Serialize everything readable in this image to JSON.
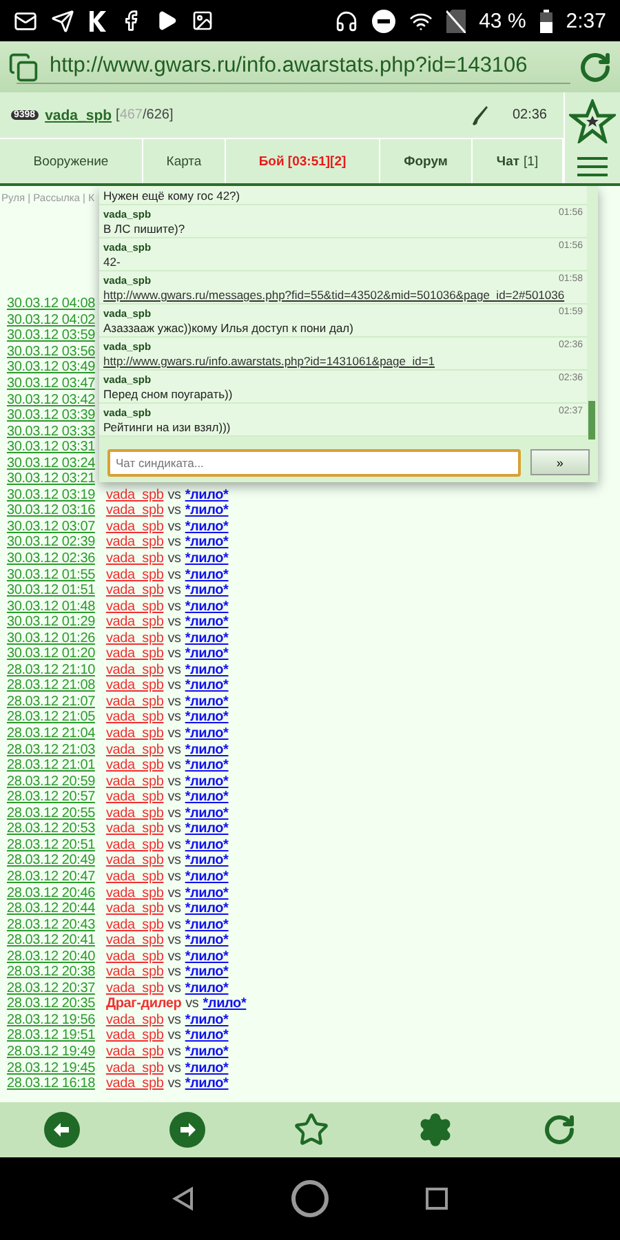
{
  "status_bar": {
    "battery": "43 %",
    "time": "2:37"
  },
  "address_bar": {
    "url": "http://www.gwars.ru/info.awarstats.php?id=143106"
  },
  "header": {
    "badge": "9398",
    "user": "vada_spb",
    "hp_current": "467",
    "hp_max": "/626]",
    "hp_open": "[",
    "time": "02:36"
  },
  "tabs": [
    {
      "label": "Вооружение",
      "kind": "plain",
      "selected": false
    },
    {
      "label": "Карта",
      "kind": "plain",
      "selected": false
    },
    {
      "label": "Бой [03:51][2]",
      "kind": "alert",
      "selected": false
    },
    {
      "label": "Форум",
      "kind": "bold",
      "selected": false
    },
    {
      "label": "Чат",
      "suffix": "[1]",
      "kind": "bold",
      "selected": false
    }
  ],
  "breadcrumb": "Руля | Рассылка | К",
  "battles": [
    {
      "date": "30.03.12 04:08"
    },
    {
      "date": "30.03.12 04:02"
    },
    {
      "date": "30.03.12 03:59"
    },
    {
      "date": "30.03.12 03:56"
    },
    {
      "date": "30.03.12 03:49"
    },
    {
      "date": "30.03.12 03:47"
    },
    {
      "date": "30.03.12 03:42"
    },
    {
      "date": "30.03.12 03:39"
    },
    {
      "date": "30.03.12 03:33"
    },
    {
      "date": "30.03.12 03:31"
    },
    {
      "date": "30.03.12 03:24"
    },
    {
      "date": "30.03.12 03:21"
    },
    {
      "date": "30.03.12 03:19",
      "player": "vada_spb",
      "player_bold": false,
      "vs": "vs",
      "opponent": "*лило*"
    },
    {
      "date": "30.03.12 03:16",
      "player": "vada_spb",
      "player_bold": false,
      "vs": "vs",
      "opponent": "*лило*"
    },
    {
      "date": "30.03.12 03:07",
      "player": "vada_spb",
      "player_bold": false,
      "vs": "vs",
      "opponent": "*лило*"
    },
    {
      "date": "30.03.12 02:39",
      "player": "vada_spb",
      "player_bold": false,
      "vs": "vs",
      "opponent": "*лило*"
    },
    {
      "date": "30.03.12 02:36",
      "player": "vada_spb",
      "player_bold": false,
      "vs": "vs",
      "opponent": "*лило*"
    },
    {
      "date": "30.03.12 01:55",
      "player": "vada_spb",
      "player_bold": false,
      "vs": "vs",
      "opponent": "*лило*"
    },
    {
      "date": "30.03.12 01:51",
      "player": "vada_spb",
      "player_bold": false,
      "vs": "vs",
      "opponent": "*лило*"
    },
    {
      "date": "30.03.12 01:48",
      "player": "vada_spb",
      "player_bold": false,
      "vs": "vs",
      "opponent": "*лило*"
    },
    {
      "date": "30.03.12 01:29",
      "player": "vada_spb",
      "player_bold": false,
      "vs": "vs",
      "opponent": "*лило*"
    },
    {
      "date": "30.03.12 01:26",
      "player": "vada_spb",
      "player_bold": false,
      "vs": "vs",
      "opponent": "*лило*"
    },
    {
      "date": "30.03.12 01:20",
      "player": "vada_spb",
      "player_bold": false,
      "vs": "vs",
      "opponent": "*лило*"
    },
    {
      "date": "28.03.12 21:10",
      "player": "vada_spb",
      "player_bold": false,
      "vs": "vs",
      "opponent": "*лило*"
    },
    {
      "date": "28.03.12 21:08",
      "player": "vada_spb",
      "player_bold": false,
      "vs": "vs",
      "opponent": "*лило*"
    },
    {
      "date": "28.03.12 21:07",
      "player": "vada_spb",
      "player_bold": false,
      "vs": "vs",
      "opponent": "*лило*"
    },
    {
      "date": "28.03.12 21:05",
      "player": "vada_spb",
      "player_bold": false,
      "vs": "vs",
      "opponent": "*лило*"
    },
    {
      "date": "28.03.12 21:04",
      "player": "vada_spb",
      "player_bold": false,
      "vs": "vs",
      "opponent": "*лило*"
    },
    {
      "date": "28.03.12 21:03",
      "player": "vada_spb",
      "player_bold": false,
      "vs": "vs",
      "opponent": "*лило*"
    },
    {
      "date": "28.03.12 21:01",
      "player": "vada_spb",
      "player_bold": false,
      "vs": "vs",
      "opponent": "*лило*"
    },
    {
      "date": "28.03.12 20:59",
      "player": "vada_spb",
      "player_bold": false,
      "vs": "vs",
      "opponent": "*лило*"
    },
    {
      "date": "28.03.12 20:57",
      "player": "vada_spb",
      "player_bold": false,
      "vs": "vs",
      "opponent": "*лило*"
    },
    {
      "date": "28.03.12 20:55",
      "player": "vada_spb",
      "player_bold": false,
      "vs": "vs",
      "opponent": "*лило*"
    },
    {
      "date": "28.03.12 20:53",
      "player": "vada_spb",
      "player_bold": false,
      "vs": "vs",
      "opponent": "*лило*"
    },
    {
      "date": "28.03.12 20:51",
      "player": "vada_spb",
      "player_bold": false,
      "vs": "vs",
      "opponent": "*лило*"
    },
    {
      "date": "28.03.12 20:49",
      "player": "vada_spb",
      "player_bold": false,
      "vs": "vs",
      "opponent": "*лило*"
    },
    {
      "date": "28.03.12 20:47",
      "player": "vada_spb",
      "player_bold": false,
      "vs": "vs",
      "opponent": "*лило*"
    },
    {
      "date": "28.03.12 20:46",
      "player": "vada_spb",
      "player_bold": false,
      "vs": "vs",
      "opponent": "*лило*"
    },
    {
      "date": "28.03.12 20:44",
      "player": "vada_spb",
      "player_bold": false,
      "vs": "vs",
      "opponent": "*лило*"
    },
    {
      "date": "28.03.12 20:43",
      "player": "vada_spb",
      "player_bold": false,
      "vs": "vs",
      "opponent": "*лило*"
    },
    {
      "date": "28.03.12 20:41",
      "player": "vada_spb",
      "player_bold": false,
      "vs": "vs",
      "opponent": "*лило*"
    },
    {
      "date": "28.03.12 20:40",
      "player": "vada_spb",
      "player_bold": false,
      "vs": "vs",
      "opponent": "*лило*"
    },
    {
      "date": "28.03.12 20:38",
      "player": "vada_spb",
      "player_bold": false,
      "vs": "vs",
      "opponent": "*лило*"
    },
    {
      "date": "28.03.12 20:37",
      "player": "vada_spb",
      "player_bold": false,
      "vs": "vs",
      "opponent": "*лило*"
    },
    {
      "date": "28.03.12 20:35",
      "player": "Драг-дилер",
      "player_bold": true,
      "vs": "vs",
      "opponent": "*лило*"
    },
    {
      "date": "28.03.12 19:56",
      "player": "vada_spb",
      "player_bold": false,
      "vs": "vs",
      "opponent": "*лило*"
    },
    {
      "date": "28.03.12 19:51",
      "player": "vada_spb",
      "player_bold": false,
      "vs": "vs",
      "opponent": "*лило*"
    },
    {
      "date": "28.03.12 19:49",
      "player": "vada_spb",
      "player_bold": false,
      "vs": "vs",
      "opponent": "*лило*"
    },
    {
      "date": "28.03.12 19:45",
      "player": "vada_spb",
      "player_bold": false,
      "vs": "vs",
      "opponent": "*лило*"
    },
    {
      "date": "28.03.12 16:18",
      "player": "vada_spb",
      "player_bold": false,
      "vs": "vs",
      "opponent": "*лило*"
    }
  ],
  "chat": {
    "messages": [
      {
        "kind": "text",
        "text": "Нужен ещё кому гос 42?)"
      },
      {
        "kind": "text",
        "author": "vada_spb",
        "time": "01:56",
        "text": "В ЛС пишите)?"
      },
      {
        "kind": "text",
        "author": "vada_spb",
        "time": "01:56",
        "text": "42-"
      },
      {
        "kind": "link",
        "author": "vada_spb",
        "time": "01:58",
        "text": "http://www.gwars.ru/messages.php?fid=55&tid=43502&mid=501036&page_id=2#501036"
      },
      {
        "kind": "text",
        "author": "vada_spb",
        "time": "01:59",
        "text": "Азаззааж ужас))кому Илья доступ к пони дал)"
      },
      {
        "kind": "link",
        "author": "vada_spb",
        "time": "02:36",
        "text": "http://www.gwars.ru/info.awarstats.php?id=1431061&page_id=1"
      },
      {
        "kind": "text",
        "author": "vada_spb",
        "time": "02:36",
        "text": "Перед сном поугарать))"
      },
      {
        "kind": "text",
        "author": "vada_spb",
        "time": "02:37",
        "text": "Рейтинги на изи взял)))"
      }
    ],
    "input": {
      "placeholder": "Чат синдиката..."
    },
    "send_button": "»"
  }
}
